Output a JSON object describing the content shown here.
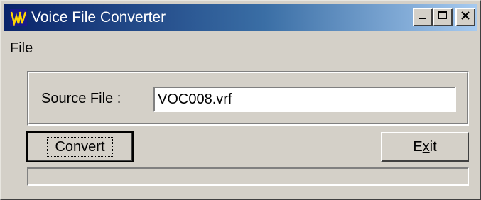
{
  "window": {
    "title": "Voice File Converter",
    "icon": "app-logo-icon",
    "caption_buttons": [
      "minimize-icon",
      "maximize-icon",
      "close-icon"
    ]
  },
  "menu": {
    "items": [
      {
        "label": "File"
      }
    ]
  },
  "source": {
    "label": "Source File :",
    "value": "VOC008.vrf"
  },
  "buttons": {
    "convert_label": "Convert",
    "exit_prefix": "E",
    "exit_mnemonic": "x",
    "exit_suffix": "it"
  },
  "progress": {
    "fraction": 0
  },
  "colors": {
    "titlebar_start": "#0a246a",
    "titlebar_end": "#a6caf0",
    "face": "#d4d0c8"
  }
}
